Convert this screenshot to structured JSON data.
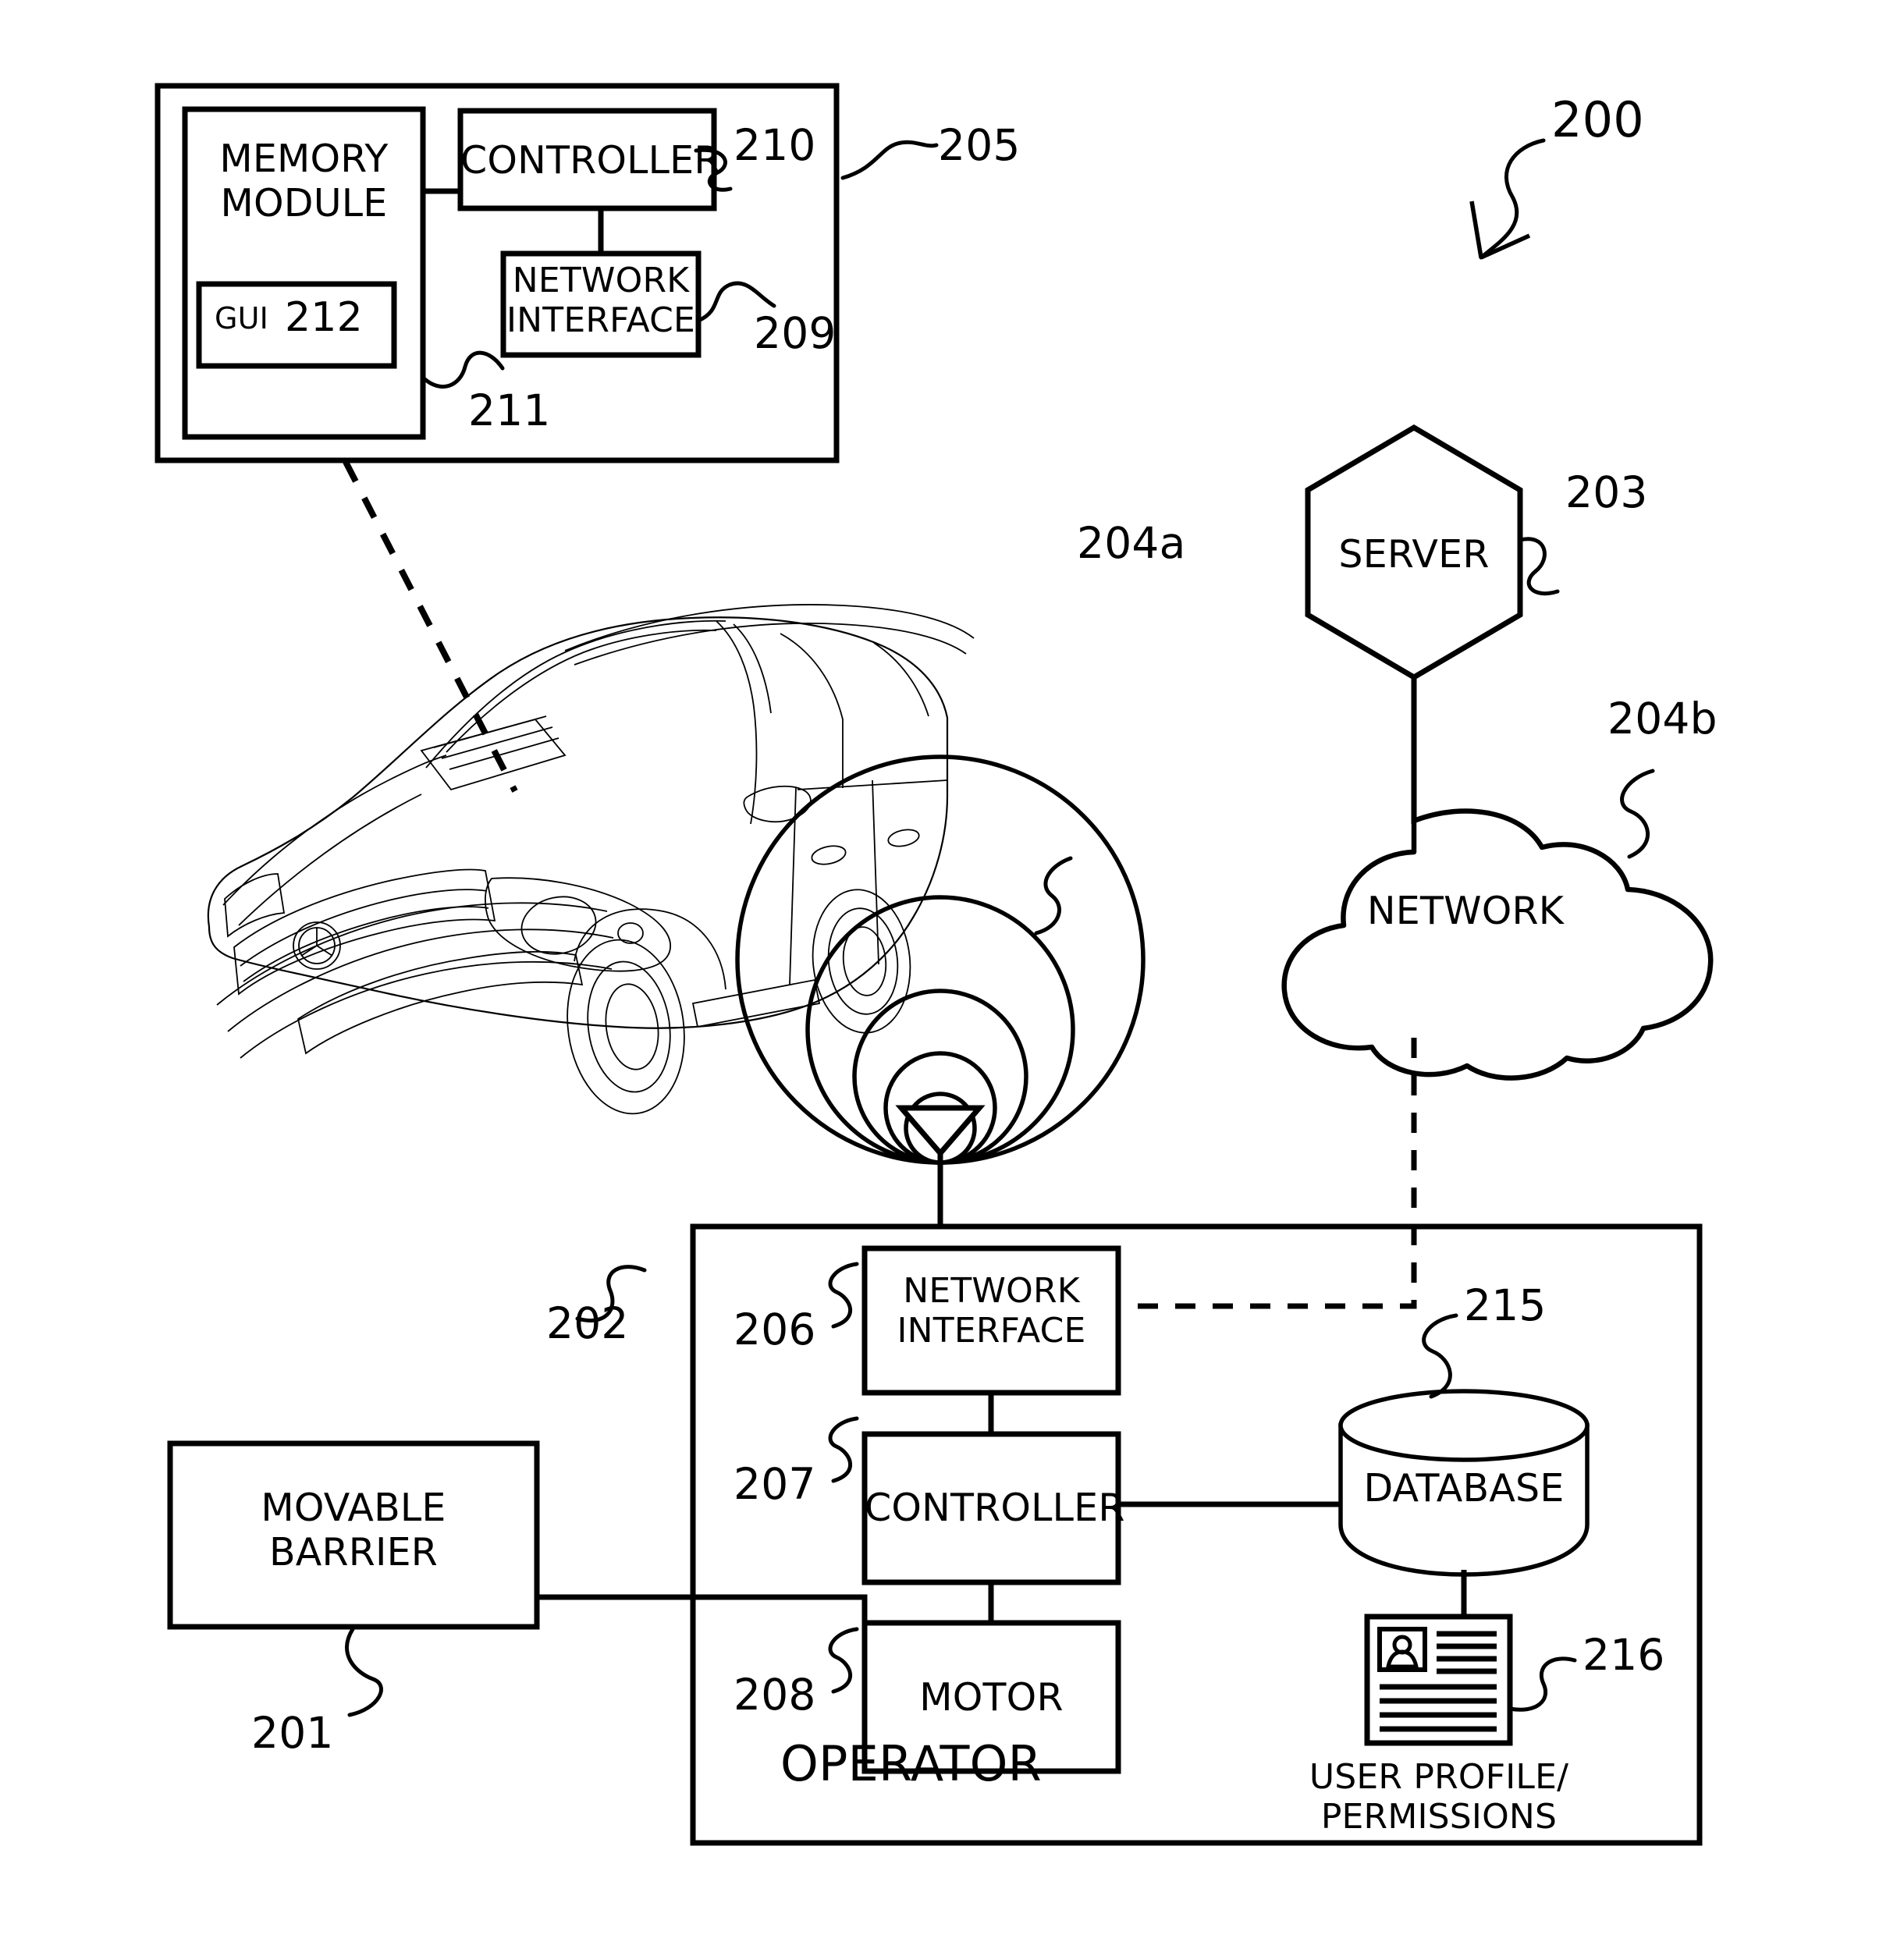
{
  "figure": {
    "title_ref": "200",
    "type": "patent-system-diagram",
    "description": "Movable barrier operator system with vehicle, server, network, and operator subsystems"
  },
  "vehicle_module": {
    "ref": "205",
    "blocks": [
      {
        "label": "MEMORY\nMODULE",
        "ref": "211",
        "name": "memory-module"
      },
      {
        "label": "CONTROLLER",
        "ref": "210",
        "name": "vehicle-controller"
      },
      {
        "label": "NETWORK\nINTERFACE",
        "ref": "209",
        "name": "vehicle-network-interface"
      }
    ],
    "gui": {
      "label": "GUI",
      "ref": "212",
      "name": "gui-block"
    }
  },
  "wireless": {
    "ref": "204a",
    "name": "wireless-signal"
  },
  "server": {
    "label": "SERVER",
    "ref": "203",
    "name": "server-node"
  },
  "network": {
    "label": "NETWORK",
    "ref": "204b",
    "name": "network-cloud"
  },
  "operator": {
    "label": "OPERATOR",
    "ref": "202",
    "blocks": [
      {
        "label": "NETWORK\nINTERFACE",
        "ref": "206",
        "name": "operator-network-interface"
      },
      {
        "label": "CONTROLLER",
        "ref": "207",
        "name": "operator-controller"
      },
      {
        "label": "MOTOR",
        "ref": "208",
        "name": "operator-motor"
      }
    ]
  },
  "barrier": {
    "label": "MOVABLE\nBARRIER",
    "ref": "201",
    "name": "movable-barrier"
  },
  "database": {
    "label": "DATABASE",
    "ref": "215",
    "name": "database-cylinder"
  },
  "user_profile": {
    "label": "USER PROFILE/\nPERMISSIONS",
    "ref": "216",
    "name": "user-profile-document"
  },
  "colors": {
    "stroke": "#000000",
    "background": "#ffffff"
  }
}
